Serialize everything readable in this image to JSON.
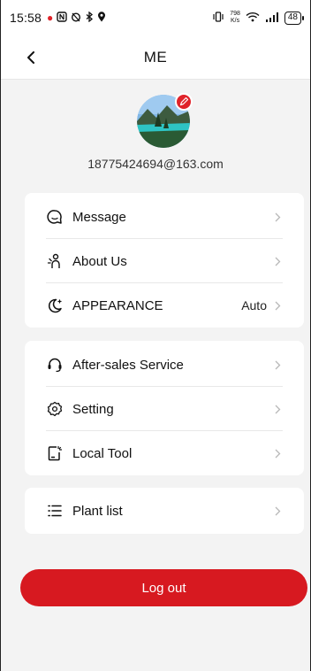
{
  "status_bar": {
    "time": "15:58",
    "net_speed_value": "798",
    "net_speed_unit": "K/s",
    "battery": "48"
  },
  "header": {
    "title": "ME"
  },
  "profile": {
    "email": "18775424694@163.com"
  },
  "menu_groups": [
    {
      "items": [
        {
          "label": "Message",
          "icon": "message-icon"
        },
        {
          "label": "About Us",
          "icon": "about-us-icon"
        },
        {
          "label": "APPEARANCE",
          "icon": "appearance-icon",
          "value": "Auto"
        }
      ]
    },
    {
      "items": [
        {
          "label": "After-sales Service",
          "icon": "headset-icon"
        },
        {
          "label": "Setting",
          "icon": "gear-icon"
        },
        {
          "label": "Local Tool",
          "icon": "local-tool-icon"
        }
      ]
    },
    {
      "items": [
        {
          "label": "Plant list",
          "icon": "list-icon"
        }
      ]
    }
  ],
  "logout_label": "Log out",
  "colors": {
    "accent": "#d71920",
    "background": "#f3f3f3",
    "card": "#ffffff"
  }
}
